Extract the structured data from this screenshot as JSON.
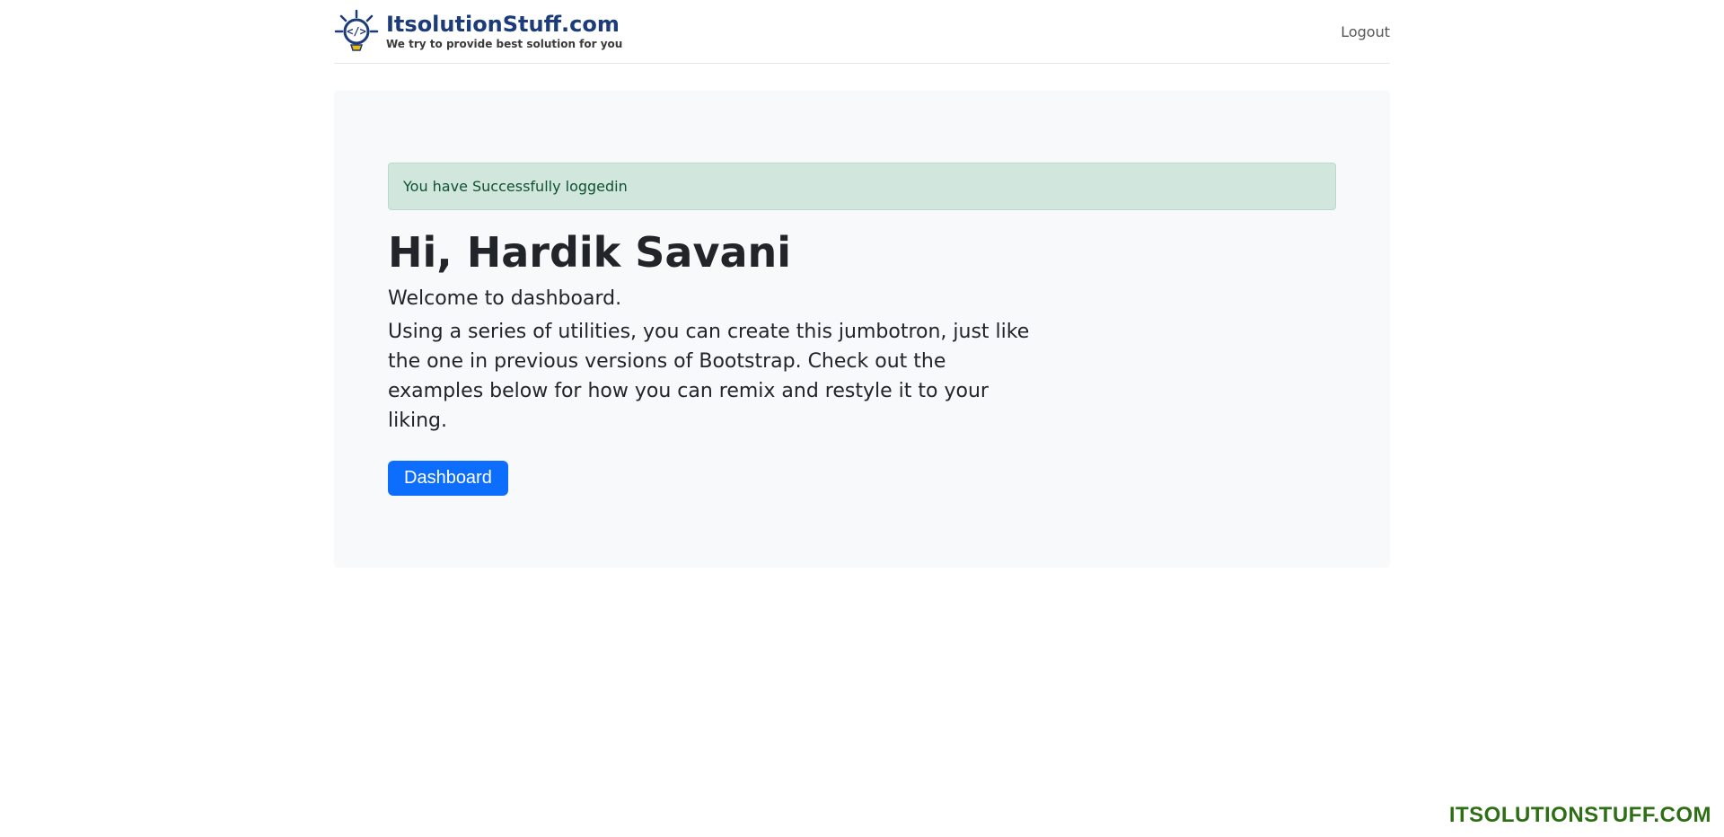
{
  "navbar": {
    "logo_title": "ItsolutionStuff.com",
    "logo_subtitle": "We try to provide best solution for you",
    "logout_label": "Logout"
  },
  "alert": {
    "message": "You have Successfully loggedin"
  },
  "jumbo": {
    "heading": "Hi, Hardik Savani",
    "lead1": "Welcome to dashboard.",
    "lead2": "Using a series of utilities, you can create this jumbotron, just like the one in previous versions of Bootstrap. Check out the examples below for how you can remix and restyle it to your liking.",
    "button_label": "Dashboard"
  },
  "watermark": "ITSOLUTIONSTUFF.COM"
}
